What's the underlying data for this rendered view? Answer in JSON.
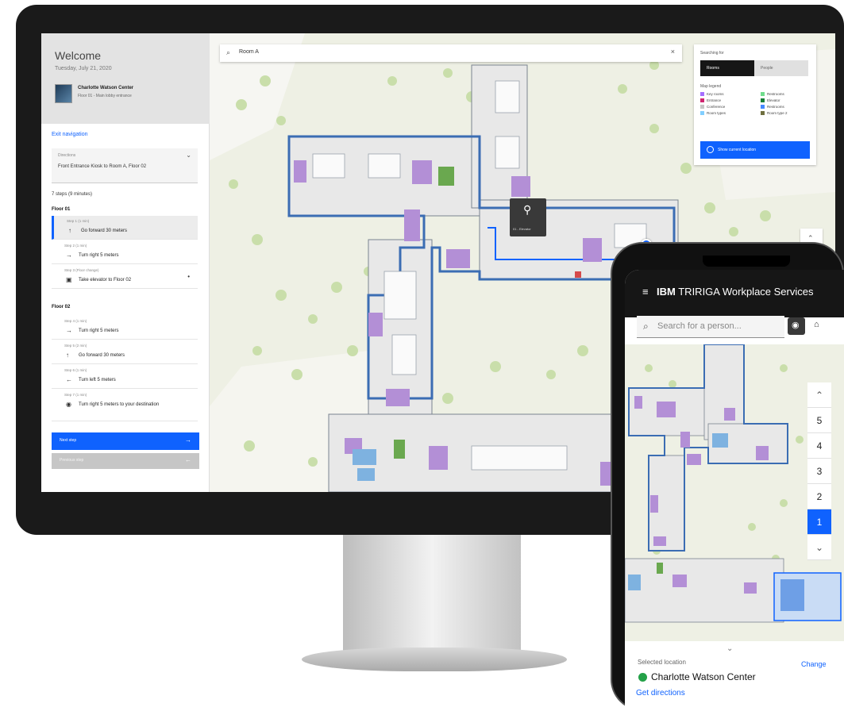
{
  "desktop": {
    "sidebar": {
      "welcome": "Welcome",
      "date": "Tuesday, July 21, 2020",
      "location_name": "Charlotte Watson Center",
      "location_sub": "Floor 01 - Main lobby entrance",
      "exit_navigation": "Exit navigation",
      "directions_label": "Directions",
      "directions_value": "Front Entrance Kiosk to Room A, Floor 02",
      "steps_summary": "7 steps (9 minutes)",
      "floors": [
        {
          "name": "Floor 01",
          "steps": [
            {
              "meta": "Step 1 (1 min)",
              "icon": "arrow-up-icon",
              "glyph": "↑",
              "text": "Go forward 30 meters",
              "active": true
            },
            {
              "meta": "Step 2 (1 min)",
              "icon": "arrow-right-icon",
              "glyph": "→",
              "text": "Turn right 5 meters",
              "active": false
            },
            {
              "meta": "Step 3 (Floor change)",
              "icon": "elevator-icon",
              "glyph": "▣",
              "text": "Take elevator to Floor 02",
              "active": false
            }
          ]
        },
        {
          "name": "Floor 02",
          "steps": [
            {
              "meta": "Step 4 (1 min)",
              "icon": "arrow-right-icon",
              "glyph": "→",
              "text": "Turn right 5 meters",
              "active": false
            },
            {
              "meta": "Step 5 (2 min)",
              "icon": "arrow-up-icon",
              "glyph": "↑",
              "text": "Go forward 30 meters",
              "active": false
            },
            {
              "meta": "Step 6 (1 min)",
              "icon": "arrow-left-icon",
              "glyph": "←",
              "text": "Turn left 5 meters",
              "active": false
            },
            {
              "meta": "Step 7 (1 min)",
              "icon": "destination-pin-icon",
              "glyph": "◉",
              "text": "Turn right 5 meters to your destination",
              "active": false
            }
          ]
        }
      ],
      "next_step": "Next step",
      "previous_step": "Previous step"
    },
    "search": {
      "value": "Room A"
    },
    "legend": {
      "title": "Searching for",
      "tab_rooms": "Rooms",
      "tab_people": "People",
      "map_legend": "Map legend",
      "items": [
        {
          "label": "Key rooms",
          "color": "#a56eff"
        },
        {
          "label": "Restrooms",
          "color": "#6fdc8c"
        },
        {
          "label": "Entrance",
          "color": "#d02670"
        },
        {
          "label": "Elevator",
          "color": "#198038"
        },
        {
          "label": "Conference",
          "color": "#c6c6c6"
        },
        {
          "label": "Restrooms",
          "color": "#4589ff"
        },
        {
          "label": "Room types",
          "color": "#82cfff"
        },
        {
          "label": "Room type 2",
          "color": "#6f6f3f"
        }
      ],
      "show_location": "Show current location"
    },
    "pin_label": "01 - Elevator"
  },
  "phone": {
    "brand": "IBM",
    "title": "TRIRIGA Workplace Services",
    "search_placeholder": "Search for a person...",
    "floors": [
      "5",
      "4",
      "3",
      "2",
      "1"
    ],
    "selected_floor": "1",
    "selected_label": "Selected location",
    "change": "Change",
    "location": "Charlotte Watson Center",
    "get_directions": "Get directions"
  },
  "colors": {
    "accent": "#0f62fe",
    "room": "#b38fd6",
    "success": "#24a148"
  }
}
